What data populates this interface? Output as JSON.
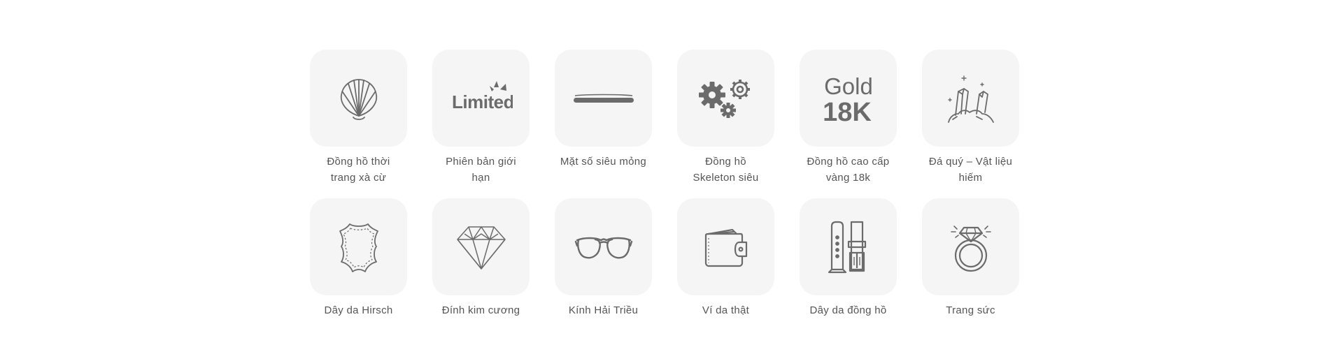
{
  "colors": {
    "tile_bg": "#f5f5f5",
    "icon": "#6b6b6b",
    "label": "#555555"
  },
  "features": [
    {
      "label": "Đồng hồ thời trang xà cừ",
      "icon": "shell-icon"
    },
    {
      "label": "Phiên bản giới hạn",
      "icon": "limited-edition-icon",
      "icon_text": "Limited"
    },
    {
      "label": "Mặt số siêu mỏng",
      "icon": "thin-dial-icon"
    },
    {
      "label": "Đồng hồ Skeleton siêu",
      "icon": "gears-icon"
    },
    {
      "label": "Đồng hồ cao cấp vàng 18k",
      "icon": "gold-18k-icon",
      "icon_text_top": "Gold",
      "icon_text_bottom": "18K"
    },
    {
      "label": "Đá quý – Vật liệu hiếm",
      "icon": "gemstone-icon"
    },
    {
      "label": "Dây da Hirsch",
      "icon": "leather-icon"
    },
    {
      "label": "Đính kim cương",
      "icon": "diamond-icon"
    },
    {
      "label": "Kính Hải Triều",
      "icon": "glasses-icon"
    },
    {
      "label": "Ví da thật",
      "icon": "wallet-icon"
    },
    {
      "label": "Dây da đồng hồ",
      "icon": "watch-strap-icon"
    },
    {
      "label": "Trang sức",
      "icon": "ring-icon"
    }
  ]
}
